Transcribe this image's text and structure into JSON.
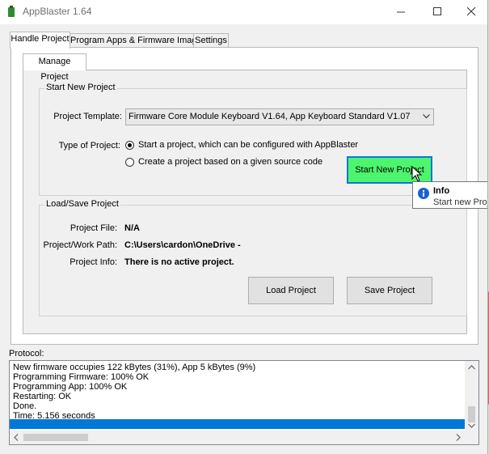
{
  "window": {
    "title": "AppBlaster 1.64"
  },
  "tabs": [
    {
      "label": "Handle Project",
      "active": true
    },
    {
      "label": "Program Apps & Firmware Images",
      "active": false
    },
    {
      "label": "Settings",
      "active": false
    }
  ],
  "inner_tab": {
    "label": "Manage Project"
  },
  "start_group": {
    "title": "Start New Project",
    "template_label": "Project Template:",
    "template_value": "Firmware Core Module Keyboard V1.64, App Keyboard Standard V1.07",
    "type_label": "Type of Project:",
    "radio_configurable": "Start a project, which can be configured with AppBlaster",
    "radio_source": "Create a project based on a given source code",
    "start_button": "Start New Project"
  },
  "tooltip": {
    "title": "Info",
    "text": "Start new Proje"
  },
  "load_group": {
    "title": "Load/Save Project",
    "file_label": "Project File:",
    "file_value": "N/A",
    "path_label": "Project/Work Path:",
    "path_value": "C:\\Users\\cardon\\OneDrive -",
    "info_label": "Project Info:",
    "info_value": "There is no active project.",
    "load_button": "Load Project",
    "save_button": "Save Project"
  },
  "protocol": {
    "label": "Protocol:",
    "lines": [
      "New firmware occupies 122 kBytes (31%), App 5 kBytes (9%)",
      "Programming Firmware: 100% OK",
      "Programming App: 100% OK",
      "Restarting: OK",
      "Done.",
      "Time: 5.156 seconds"
    ]
  },
  "colors": {
    "start_button_bg": "#4cf56d",
    "focus_border": "#0a78d7",
    "selection": "#0078d7"
  }
}
